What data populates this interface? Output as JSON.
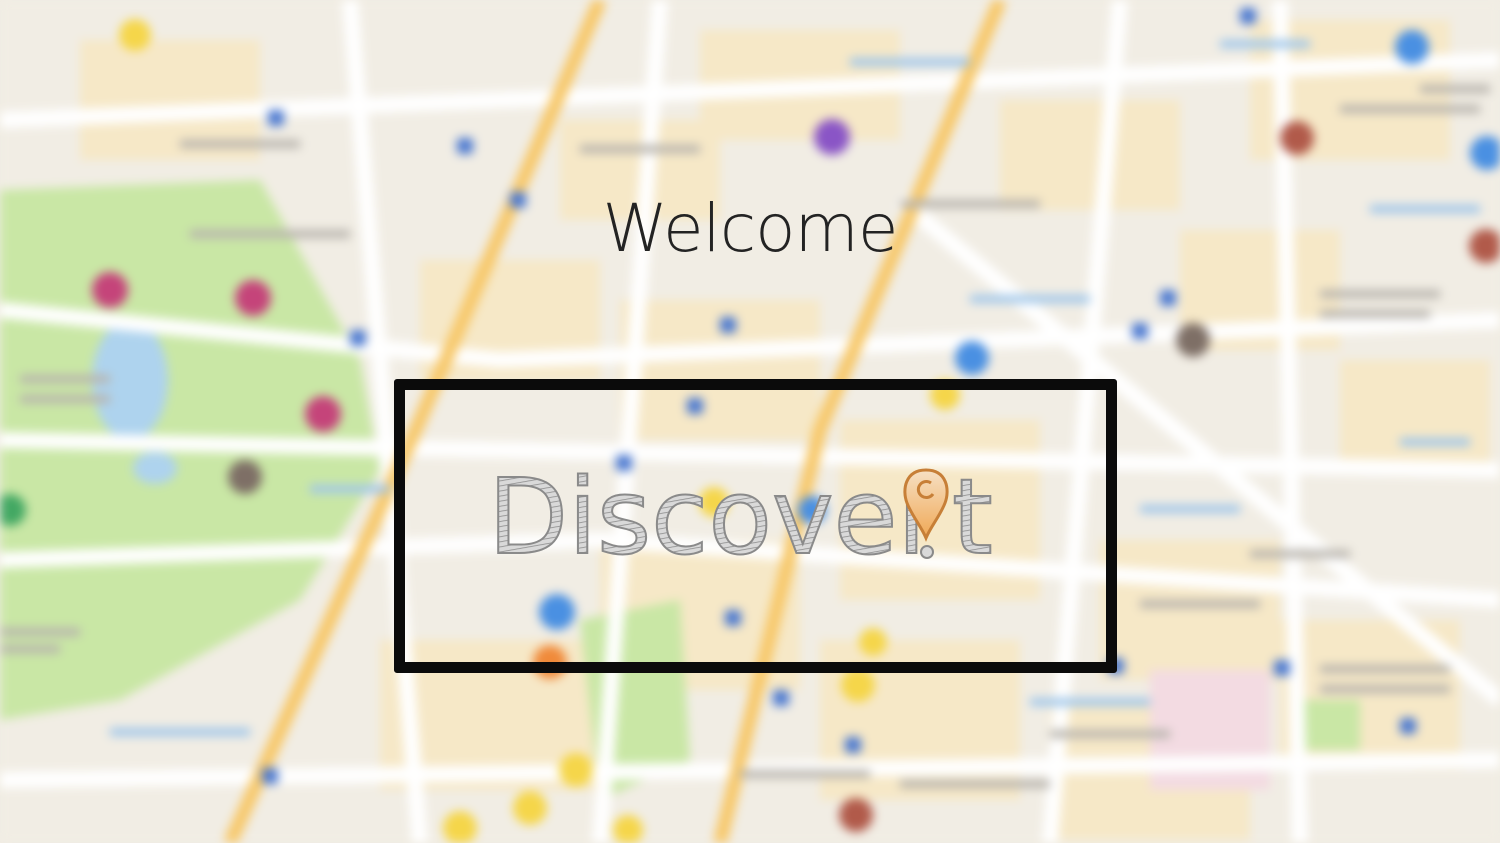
{
  "screen": {
    "title": "Welcome"
  },
  "logo": {
    "text_before": "Discover",
    "text_after": "t",
    "full_name": "Discover!t",
    "icon": "map-pin-icon",
    "colors": {
      "pin_stroke": "#c77f37",
      "pin_fill": "#f4b46a",
      "text_stroke": "#8a8a8a"
    }
  },
  "colors": {
    "background": "#f1ede4",
    "park": "#c9e7a5",
    "road_major": "#f7c86a",
    "frame": "#0b0b0b",
    "title": "#232323"
  }
}
